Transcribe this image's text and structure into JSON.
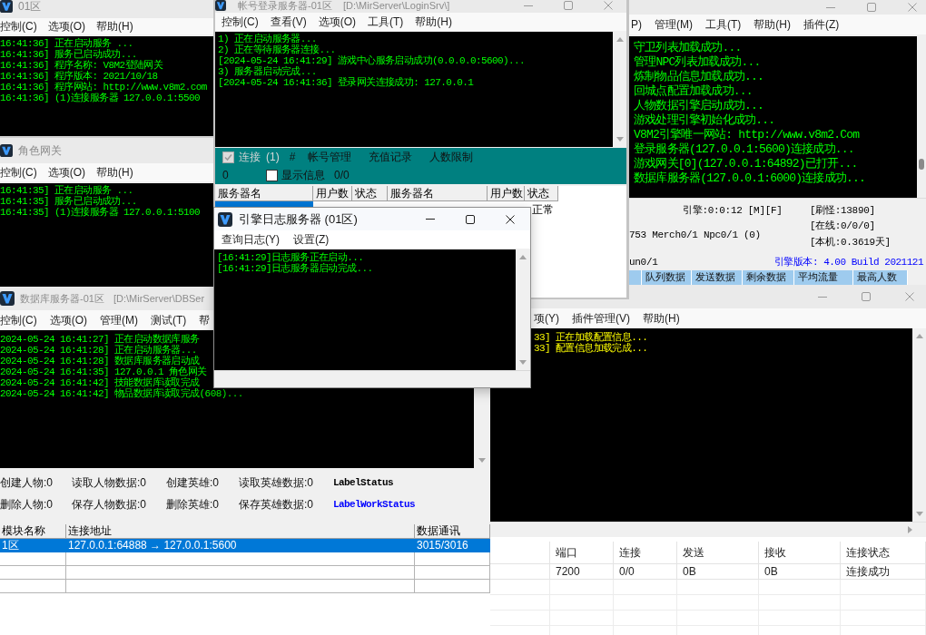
{
  "login_gate_window": {
    "title": "01区",
    "active": false,
    "menu": [
      "控制(C)",
      "选项(O)",
      "帮助(H)"
    ],
    "log": [
      "16:41:36] 正在启动服务 ...",
      "16:41:36] 服务已启动成功...",
      "16:41:36] 程序名称: V8M2登陆网关",
      "16:41:36] 程序版本: 2021/10/18",
      "16:41:36] 程序网站: http://www.v8m2.com",
      "16:41:36] (1)连接服务器 127.0.0.1:5500"
    ]
  },
  "role_gate_window": {
    "title": "角色网关",
    "active": false,
    "menu": [
      "控制(C)",
      "选项(O)",
      "帮助(H)"
    ],
    "log": [
      "16:41:35] 正在启动服务 ...",
      "16:41:35] 服务已启动成功...",
      "16:41:35] (1)连接服务器 127.0.0.1:5100"
    ]
  },
  "engine_window": {
    "menu": [
      "P)",
      "管理(M)",
      "工具(T)",
      "帮助(H)",
      "插件(Z)"
    ],
    "log": [
      "守卫列表加载成功...",
      "管理NPC列表加载成功...",
      "炼制物品信息加载成功...",
      "回城点配置加载成功...",
      "人物数据引擎启动成功...",
      "游戏处理引擎初始化成功...",
      "V8M2引擎唯一网站: http://www.v8m2.Com",
      "登录服务器(127.0.0.1:5600)连接成功...",
      "游戏网关[0](127.0.0.1:64892)已打开...",
      "数据库服务器(127.0.0.1:6000)连接成功..."
    ],
    "status": {
      "engine": "引擎:0:0:12 [M][F]",
      "merchants": "753 Merch0/1 Npc0/1 (0)",
      "run": "un0/1",
      "monsters": "[刷怪:13890]",
      "online": "[在线:0/0/0]",
      "uptime": "[本机:0.3619天]",
      "version": "引擎版本: 4.00 Build 2021121"
    },
    "columns": [
      "队列数据",
      "发送数据",
      "剩余数据",
      "平均流量",
      "最高人数"
    ]
  },
  "bottom_right_window": {
    "menu": [
      "项(Y)",
      "插件管理(V)",
      "帮助(H)"
    ],
    "log": [
      "33] 正在加载配置信息...",
      "33] 配置信息加载完成..."
    ],
    "table": {
      "columns": [
        "端口",
        "连接",
        "发送",
        "接收",
        "连接状态"
      ],
      "rows": [
        [
          "7200",
          "0/0",
          "0B",
          "0B",
          "连接成功"
        ]
      ]
    }
  },
  "login_server_window": {
    "title": "帐号登录服务器-01区",
    "path": "[D:\\MirServer\\LoginSrv\\]",
    "active": false,
    "menu": [
      "控制(C)",
      "查看(V)",
      "选项(O)",
      "工具(T)",
      "帮助(H)"
    ],
    "log": [
      "1) 正在启动服务器...",
      "2) 正在等待服务器连接...",
      "[2024-05-24 16:41:29] 游戏中心服务启动成功(0.0.0.0:5600)...",
      "3) 服务器启动完成...",
      "[2024-05-24 16:41:36] 登录网关连接成功: 127.0.0.1"
    ],
    "panel": {
      "connect": {
        "label": "连接",
        "checked": true,
        "disabled": true
      },
      "count": "(1)",
      "hash": "#",
      "links": [
        "帐号管理",
        "充值记录",
        "人数限制"
      ],
      "value": "0",
      "show_info": {
        "label": "显示信息",
        "checked": false
      },
      "ratio": "0/0"
    },
    "table": {
      "columns": [
        "服务器名",
        "用户数",
        "状态",
        "服务器名",
        "用户数",
        "状态"
      ],
      "rows": [
        {
          "selected": true,
          "status": "正常"
        }
      ]
    }
  },
  "db_window": {
    "title": "数据库服务器-01区",
    "path": "[D:\\MirServer\\DBSer",
    "active": false,
    "menu": [
      "控制(C)",
      "选项(O)",
      "管理(M)",
      "测试(T)",
      "帮"
    ],
    "log": [
      "2024-05-24 16:41:27] 正在启动数据库服务",
      "2024-05-24 16:41:28] 正在启动服务器...",
      "2024-05-24 16:41:28] 数据库服务器启动成",
      "2024-05-24 16:41:35] 127.0.0.1 角色网关",
      "2024-05-24 16:41:42] 技能数据库读取完成",
      "2024-05-24 16:41:42] 物品数据库读取完成(608)..."
    ],
    "stats": [
      {
        "items": [
          "创建人物:0",
          "读取人物数据:0",
          "创建英雄:0",
          "读取英雄数据:0"
        ],
        "label": {
          "text": "LabelStatus",
          "color": "#000000"
        }
      },
      {
        "items": [
          "删除人物:0",
          "保存人物数据:0",
          "删除英雄:0",
          "保存英雄数据:0"
        ],
        "label": {
          "text": "LabelWorkStatus",
          "color": "#0000ff"
        }
      }
    ],
    "table": {
      "columns": [
        "模块名称",
        "连接地址",
        "数据通讯"
      ],
      "rows": [
        {
          "selected": true,
          "cells": [
            "1区",
            "127.0.0.1:64888 → 127.0.0.1:5600",
            "3015/3016"
          ]
        }
      ]
    }
  },
  "log_window": {
    "title": "引擎日志服务器 (01区)",
    "active": true,
    "menu": [
      "查询日志(Y)",
      "设置(Z)"
    ],
    "log": [
      "[16:41:29]日志服务正在启动...",
      "[16:41:29]日志服务器启动完成..."
    ]
  }
}
